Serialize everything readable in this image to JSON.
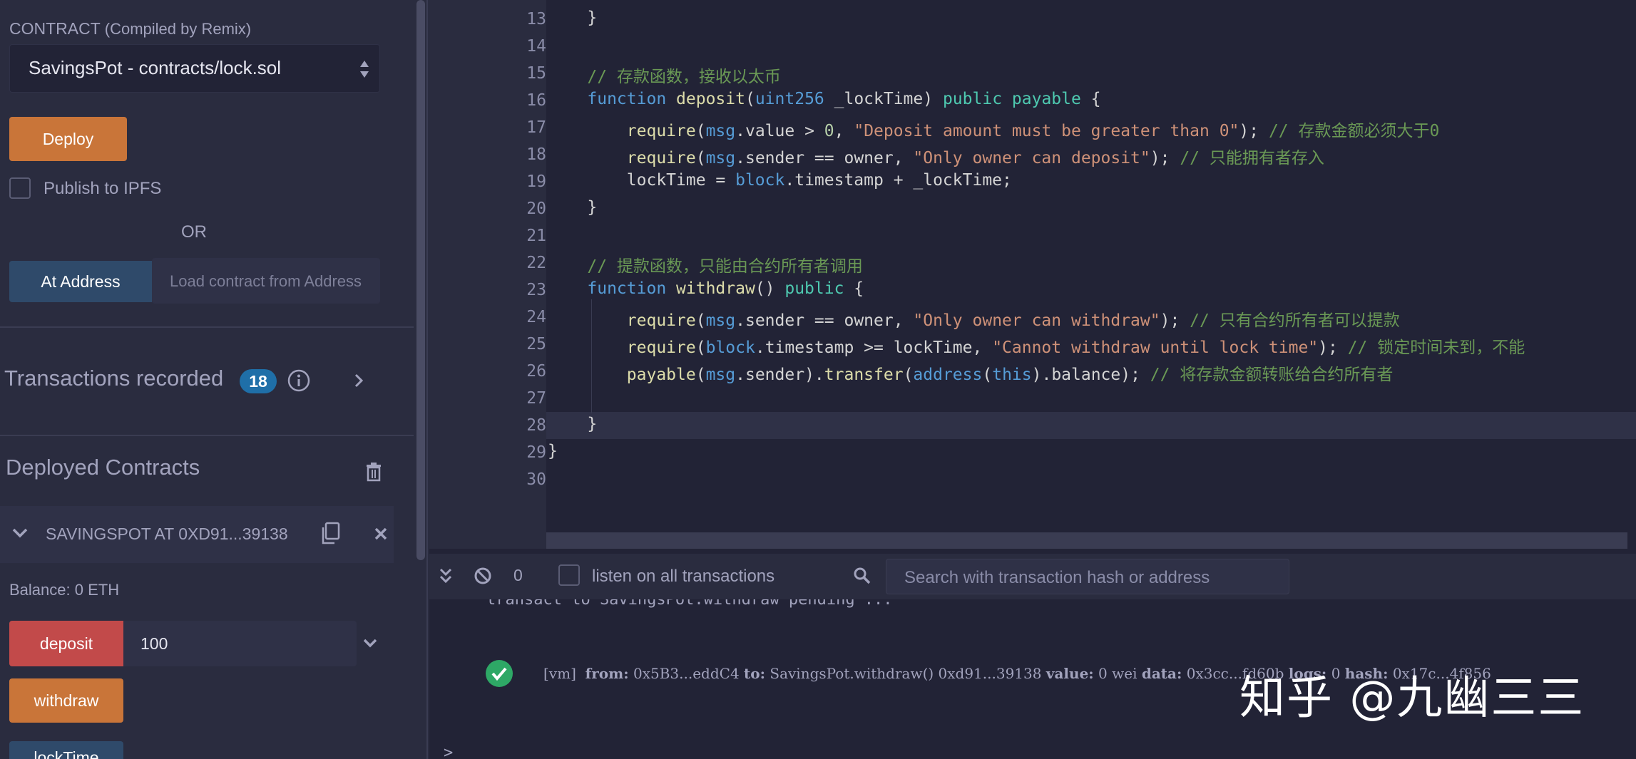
{
  "left": {
    "contract_label": "CONTRACT",
    "contract_label_sub": "(Compiled by Remix)",
    "contract_select_value": "SavingsPot - contracts/lock.sol",
    "deploy_label": "Deploy",
    "publish_ipfs_label": "Publish to IPFS",
    "or_label": "OR",
    "at_address_label": "At Address",
    "at_address_placeholder": "Load contract from Address",
    "transactions_label": "Transactions recorded",
    "transactions_count": "18",
    "deployed_label": "Deployed Contracts",
    "instance_title": "SAVINGSPOT AT 0XD91...39138",
    "balance_label": "Balance: 0 ETH",
    "deposit_label": "deposit",
    "deposit_value": "100",
    "withdraw_label": "withdraw",
    "locktime_label": "lockTime"
  },
  "editor": {
    "lines": [
      {
        "num": "13",
        "text": "    }"
      },
      {
        "num": "14",
        "text": ""
      },
      {
        "num": "15",
        "text": "    // 存款函数，接收以太币"
      },
      {
        "num": "16",
        "text": "    function deposit(uint256 _lockTime) public payable {"
      },
      {
        "num": "17",
        "text": "        require(msg.value > 0, \"Deposit amount must be greater than 0\"); // 存款金额必须大于0"
      },
      {
        "num": "18",
        "text": "        require(msg.sender == owner, \"Only owner can deposit\"); // 只能拥有者存入"
      },
      {
        "num": "19",
        "text": "        lockTime = block.timestamp + _lockTime;"
      },
      {
        "num": "20",
        "text": "    }"
      },
      {
        "num": "21",
        "text": ""
      },
      {
        "num": "22",
        "text": "    // 提款函数，只能由合约所有者调用"
      },
      {
        "num": "23",
        "text": "    function withdraw() public {"
      },
      {
        "num": "24",
        "text": "        require(msg.sender == owner, \"Only owner can withdraw\"); // 只有合约所有者可以提款"
      },
      {
        "num": "25",
        "text": "        require(block.timestamp >= lockTime, \"Cannot withdraw until lock time\"); // 锁定时间未到，不能"
      },
      {
        "num": "26",
        "text": "        payable(msg.sender).transfer(address(this).balance); // 将存款金额转账给合约所有者"
      },
      {
        "num": "27",
        "text": ""
      },
      {
        "num": "28",
        "text": "    }"
      },
      {
        "num": "29",
        "text": "}"
      },
      {
        "num": "30",
        "text": ""
      }
    ]
  },
  "terminal": {
    "count": "0",
    "listen_label": "listen on all transactions",
    "search_placeholder": "Search with transaction hash or address",
    "pending_line": "transact to SavingsPot.withdraw pending ...",
    "log_vm": "[vm]",
    "log_from_key": "from:",
    "log_from": "0x5B3...eddC4",
    "log_to_key": "to:",
    "log_to": "SavingsPot.withdraw() 0xd91...39138",
    "log_value_key": "value:",
    "log_value": "0 wei",
    "log_data_key": "data:",
    "log_data": "0x3cc...fd60b",
    "log_logs_key": "logs:",
    "log_logs": "0",
    "log_hash_key": "hash:",
    "log_hash": "0x17c...4f856",
    "prompt": ">"
  },
  "watermark": "知乎 @九幽三三",
  "colors": {
    "bg": "#222336",
    "panel": "#2a2c3f",
    "deploy": "#c97539",
    "at_address": "#2f4a6a",
    "deposit": "#c24a4a",
    "badge": "#1f6fa8",
    "success": "#2ea866"
  }
}
